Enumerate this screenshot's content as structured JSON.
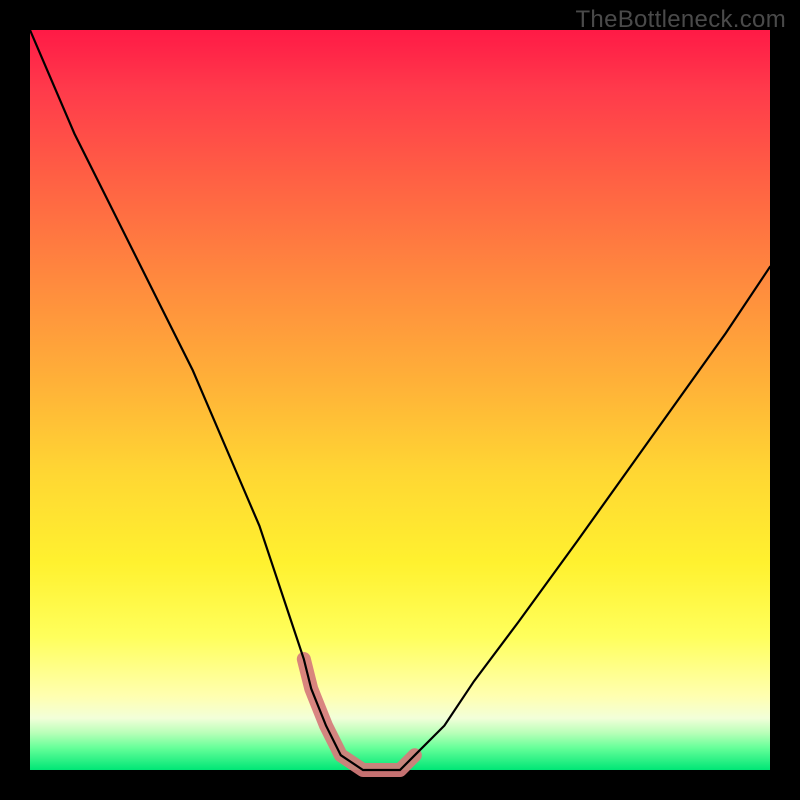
{
  "watermark": "TheBottleneck.com",
  "colors": {
    "frame": "#000000",
    "watermark_text": "#4a4a4a",
    "curve": "#000000",
    "highlight": "#d67b7b",
    "gradient_stops": [
      "#ff1a46",
      "#ff3a4b",
      "#ff6044",
      "#ff8a3e",
      "#ffb238",
      "#ffd733",
      "#fff12f",
      "#ffff5c",
      "#ffffb0",
      "#f2ffd9",
      "#b8ffb8",
      "#66ff99",
      "#00e676"
    ]
  },
  "chart_data": {
    "type": "line",
    "title": "",
    "xlabel": "",
    "ylabel": "",
    "xlim": [
      0,
      100
    ],
    "ylim": [
      0,
      100
    ],
    "grid": false,
    "legend": false,
    "annotations": [
      "TheBottleneck.com"
    ],
    "series": [
      {
        "name": "bottleneck-curve",
        "x": [
          0,
          3,
          6,
          10,
          14,
          18,
          22,
          25,
          28,
          31,
          33,
          35,
          37,
          38,
          40,
          42,
          45,
          48,
          50,
          52,
          56,
          60,
          66,
          74,
          84,
          94,
          100
        ],
        "y": [
          100,
          93,
          86,
          78,
          70,
          62,
          54,
          47,
          40,
          33,
          27,
          21,
          15,
          11,
          6,
          2,
          0,
          0,
          0,
          2,
          6,
          12,
          20,
          31,
          45,
          59,
          68
        ]
      }
    ],
    "highlight_region": {
      "name": "optimal-zone",
      "x": [
        37,
        38,
        40,
        42,
        45,
        48,
        50,
        52
      ],
      "y": [
        15,
        11,
        6,
        2,
        0,
        0,
        0,
        2
      ]
    }
  }
}
